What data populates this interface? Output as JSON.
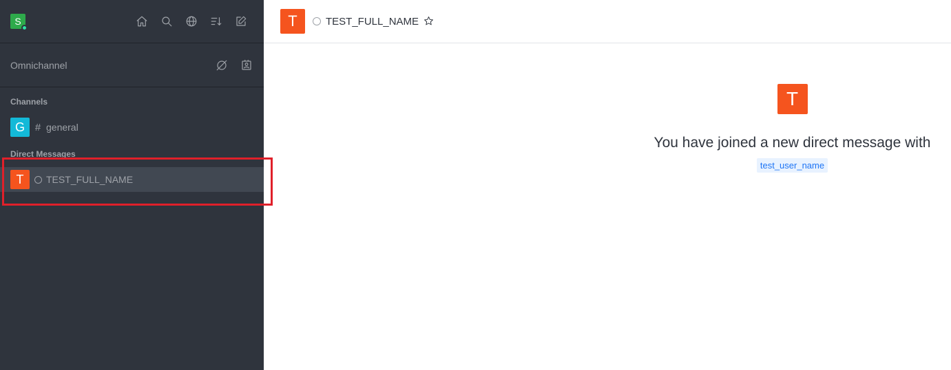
{
  "user": {
    "avatar_letter": "S",
    "avatar_color": "#2eaa4b",
    "status_color": "#2de0a5"
  },
  "sidebar": {
    "header_icons": [
      "home-icon",
      "search-icon",
      "directory-icon",
      "sort-icon",
      "create-new-icon"
    ],
    "omnichannel": {
      "label": "Omnichannel",
      "icons": [
        "omnichannel-status-icon",
        "contact-center-icon"
      ]
    },
    "sections": {
      "channels": "Channels",
      "direct_messages": "Direct Messages"
    },
    "channels": [
      {
        "avatar_letter": "G",
        "prefix": "#",
        "name": "general",
        "color": "#13b9d8"
      }
    ],
    "direct_messages": [
      {
        "avatar_letter": "T",
        "name": "TEST_FULL_NAME",
        "color": "#f5541e",
        "selected": true
      }
    ]
  },
  "room": {
    "avatar_letter": "T",
    "title": "TEST_FULL_NAME",
    "welcome_text": "You have joined a new direct message with",
    "username": "test_user_name"
  }
}
